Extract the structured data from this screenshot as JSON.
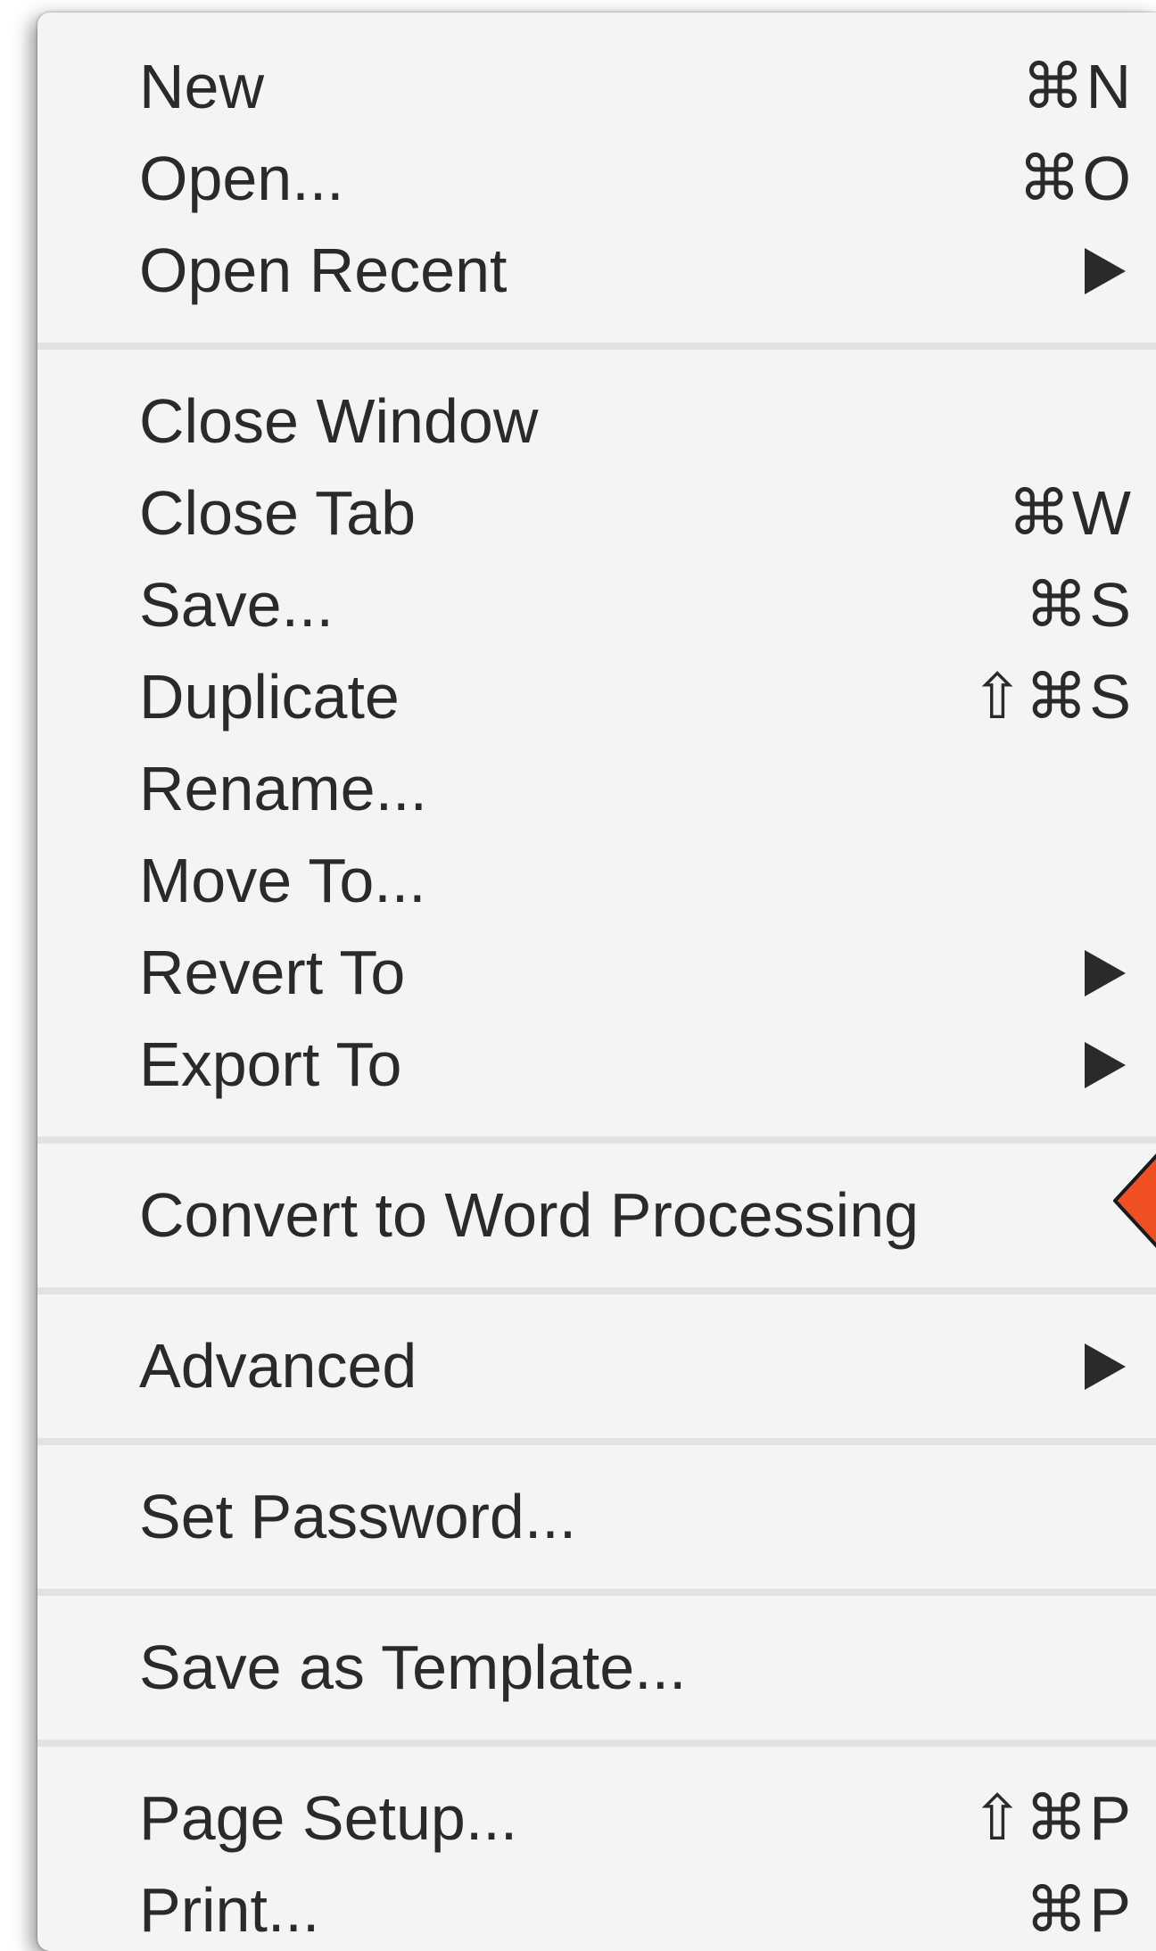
{
  "menu": {
    "groups": [
      [
        {
          "label": "New",
          "shortcut": "⌘N",
          "submenu": false
        },
        {
          "label": "Open...",
          "shortcut": "⌘O",
          "submenu": false
        },
        {
          "label": "Open Recent",
          "shortcut": "",
          "submenu": true
        }
      ],
      [
        {
          "label": "Close Window",
          "shortcut": "",
          "submenu": false
        },
        {
          "label": "Close Tab",
          "shortcut": "⌘W",
          "submenu": false
        },
        {
          "label": "Save...",
          "shortcut": "⌘S",
          "submenu": false
        },
        {
          "label": "Duplicate",
          "shortcut": "⇧⌘S",
          "submenu": false
        },
        {
          "label": "Rename...",
          "shortcut": "",
          "submenu": false
        },
        {
          "label": "Move To...",
          "shortcut": "",
          "submenu": false
        },
        {
          "label": "Revert To",
          "shortcut": "",
          "submenu": true
        },
        {
          "label": "Export To",
          "shortcut": "",
          "submenu": true
        }
      ],
      [
        {
          "label": "Convert to Word Processing",
          "shortcut": "",
          "submenu": false
        }
      ],
      [
        {
          "label": "Advanced",
          "shortcut": "",
          "submenu": true
        }
      ],
      [
        {
          "label": "Set Password...",
          "shortcut": "",
          "submenu": false
        }
      ],
      [
        {
          "label": "Save as Template...",
          "shortcut": "",
          "submenu": false
        }
      ],
      [
        {
          "label": "Page Setup...",
          "shortcut": "⇧⌘P",
          "submenu": false
        },
        {
          "label": "Print...",
          "shortcut": "⌘P",
          "submenu": false
        }
      ]
    ]
  },
  "colors": {
    "menu_background": "#f4f4f4",
    "separator": "#e2e2e2",
    "text": "#2a2a2a",
    "callout_fill": "#f04e23",
    "callout_stroke": "#1a1a1a"
  },
  "icons": {
    "submenu": "triangle-right-icon",
    "callout": "red-callout-arrow-icon"
  }
}
